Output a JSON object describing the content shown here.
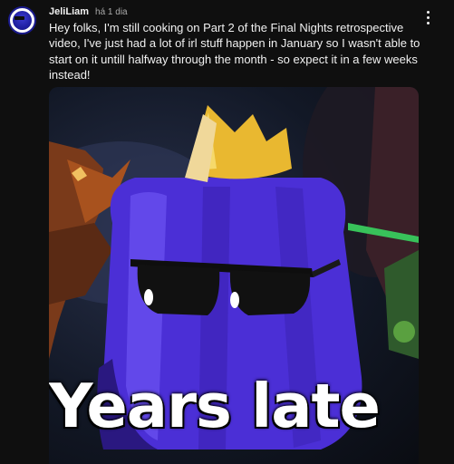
{
  "post": {
    "author": "JeliLiam",
    "time": "há 1 dia",
    "text": "Hey folks, I'm still cooking on Part 2 of the Final Nights retrospective video, I've just had a lot of irl stuff happen in January so I wasn't able to start on it untill halfway through the month - so expect it in a few weeks instead!",
    "more_icon": "more-vert-icon",
    "avatar_icon": "channel-avatar",
    "thumbnail": {
      "overlay_text": "Years late",
      "accent_color": "#4b2fd6"
    }
  }
}
